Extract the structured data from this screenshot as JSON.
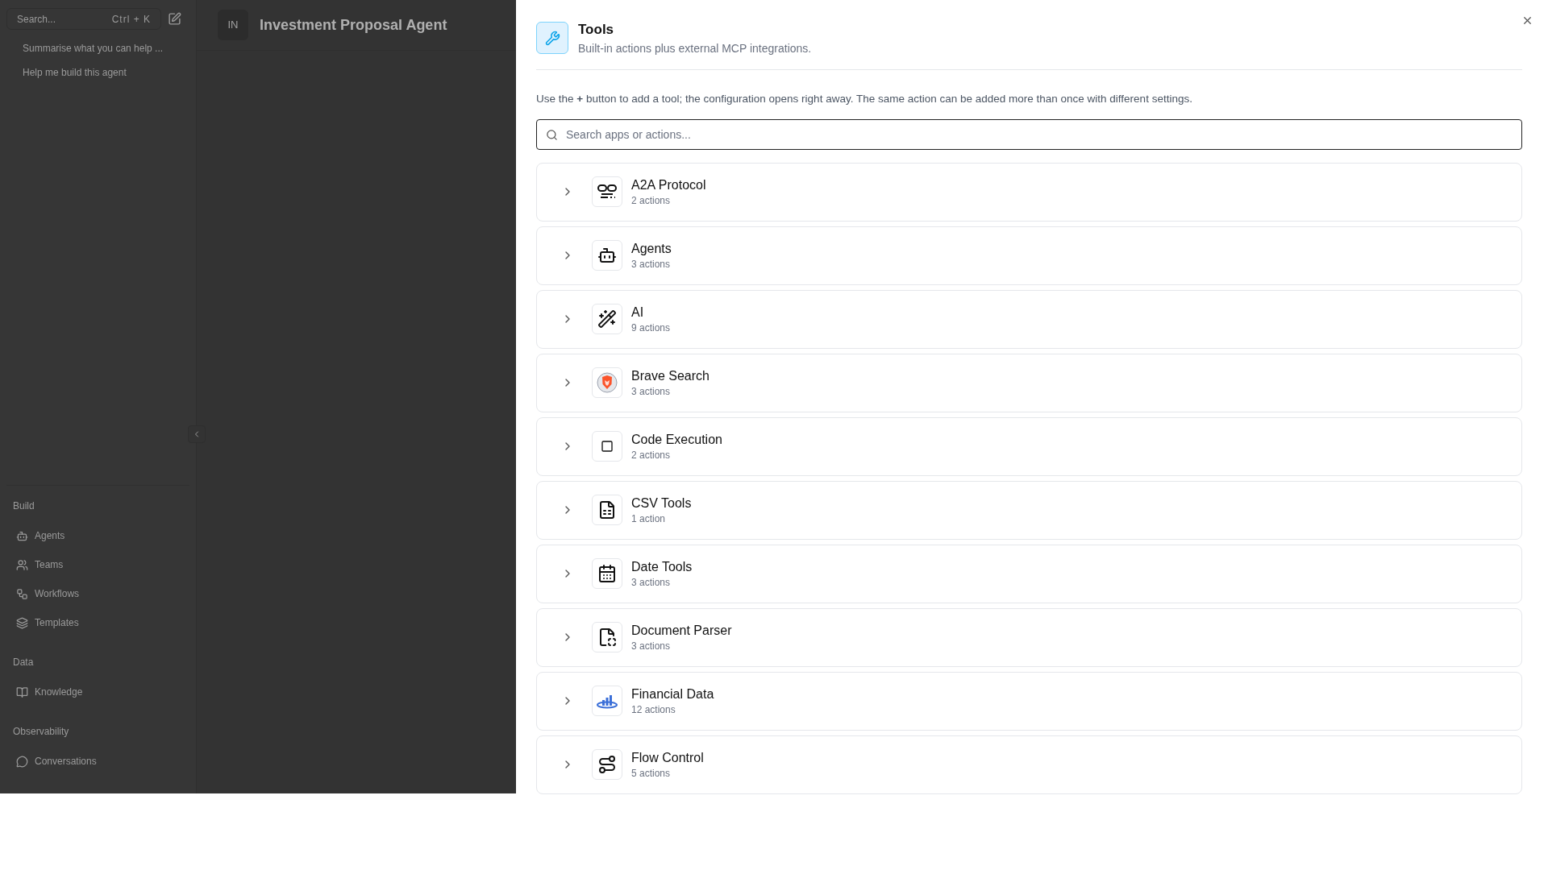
{
  "sidebar": {
    "search": {
      "placeholder": "Search...",
      "shortcut": "Ctrl + K"
    },
    "chats": [
      "Summarise what you can help ...",
      "Help me build this agent"
    ],
    "sections": [
      {
        "title": "Build",
        "items": [
          {
            "label": "Agents"
          },
          {
            "label": "Teams"
          },
          {
            "label": "Workflows"
          },
          {
            "label": "Templates"
          }
        ]
      },
      {
        "title": "Data",
        "items": [
          {
            "label": "Knowledge"
          }
        ]
      },
      {
        "title": "Observability",
        "items": [
          {
            "label": "Conversations"
          }
        ]
      }
    ]
  },
  "header": {
    "badge": "IN",
    "title": "Investment Proposal Agent"
  },
  "dialog": {
    "title": "Tools",
    "subtitle": "Built-in actions plus external MCP integrations.",
    "hint": "Use the **+** button to add a tool; the configuration opens right away. The same action can be added more than once with different settings.",
    "search": {
      "placeholder": "Search apps or actions..."
    },
    "tools": [
      {
        "name": "A2A Protocol",
        "count": "2 actions",
        "expanded": false
      },
      {
        "name": "Agents",
        "count": "3 actions",
        "expanded": false
      },
      {
        "name": "AI",
        "count": "9 actions",
        "expanded": false
      },
      {
        "name": "Brave Search",
        "count": "3 actions",
        "expanded": false
      },
      {
        "name": "Code Execution",
        "count": "2 actions",
        "expanded": false
      },
      {
        "name": "CSV Tools",
        "count": "1 action",
        "expanded": false
      },
      {
        "name": "Date Tools",
        "count": "3 actions",
        "expanded": false
      },
      {
        "name": "Document Parser",
        "count": "3 actions",
        "expanded": false
      },
      {
        "name": "Financial Data",
        "count": "12 actions",
        "expanded": false
      },
      {
        "name": "Flow Control",
        "count": "5 actions",
        "expanded": false
      }
    ]
  }
}
